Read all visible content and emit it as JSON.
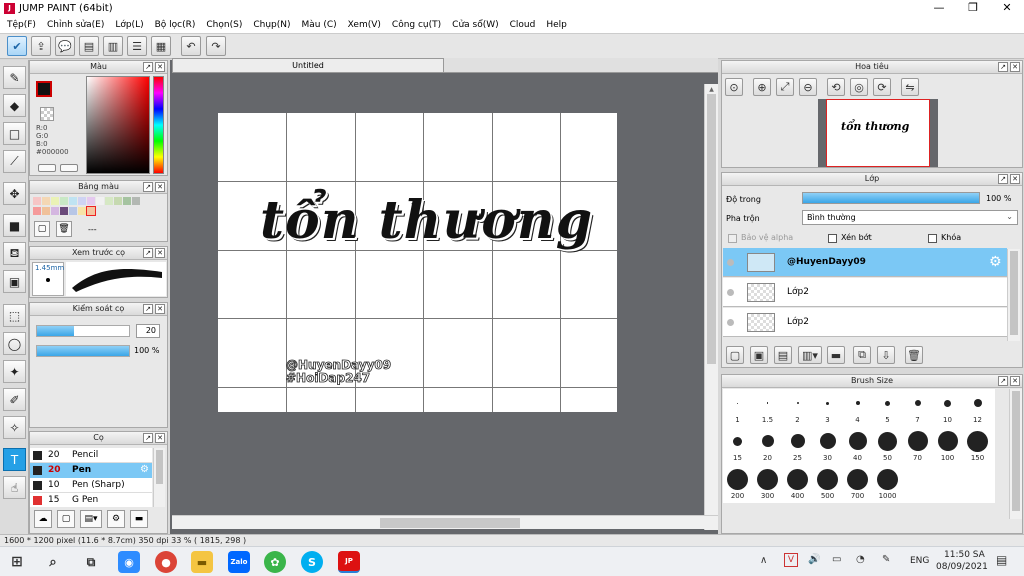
{
  "window": {
    "title": "JUMP PAINT (64bit)",
    "minimize": "—",
    "maximize": "❐",
    "close": "✕"
  },
  "menu": [
    "Tệp(F)",
    "Chỉnh sửa(E)",
    "Lớp(L)",
    "Bộ lọc(R)",
    "Chọn(S)",
    "Chụp(N)",
    "Màu (C)",
    "Xem(V)",
    "Công cụ(T)",
    "Cửa sổ(W)",
    "Cloud",
    "Help"
  ],
  "color_panel": {
    "title": "Màu",
    "r": "R:0",
    "g": "G:0",
    "b": "B:0",
    "hex": "#000000"
  },
  "palette_panel": {
    "title": "Bảng màu",
    "extra": "---"
  },
  "brush_preview_panel": {
    "title": "Xem trước cọ",
    "size": "1.45mm"
  },
  "brush_control_panel": {
    "title": "Kiểm soát cọ",
    "size_value": "20",
    "opacity_value": "100 %",
    "size_level": 0.4,
    "opacity_level": 1.0
  },
  "brush_panel": {
    "title": "Cọ",
    "items": [
      {
        "size": "20",
        "name": "Pencil",
        "color": "#222222"
      },
      {
        "size": "20",
        "name": "Pen",
        "color": "#222222",
        "selected": true
      },
      {
        "size": "10",
        "name": "Pen (Sharp)",
        "color": "#222222"
      },
      {
        "size": "15",
        "name": "G Pen",
        "color": "#e03030"
      }
    ]
  },
  "document": {
    "tab": "Untitled",
    "artwork_title": "tổn thương",
    "signature_line1": "@HuyenDayy09",
    "signature_line2": "#HoiDap247"
  },
  "navigator_panel": {
    "title": "Hoa tiêu",
    "thumb_text": "tổn thương"
  },
  "layer_panel": {
    "title": "Lớp",
    "opacity_label": "Độ trong",
    "opacity_value": "100 %",
    "blend_label": "Pha trộn",
    "blend_value": "Bình thường",
    "protect_alpha": "Bảo vệ alpha",
    "clip": "Xén bớt",
    "lock": "Khóa",
    "layers": [
      {
        "name": "@HuyenDayy09",
        "selected": true
      },
      {
        "name": "Lớp2",
        "selected": false
      },
      {
        "name": "Lớp2",
        "selected": false
      }
    ]
  },
  "brush_size_panel": {
    "title": "Brush Size",
    "sizes": [
      "1",
      "1.5",
      "2",
      "3",
      "4",
      "5",
      "7",
      "10",
      "12",
      "15",
      "20",
      "25",
      "30",
      "40",
      "50",
      "70",
      "100",
      "150",
      "200",
      "300",
      "400",
      "500",
      "700",
      "1000"
    ]
  },
  "status": {
    "text": "1600 * 1200 pixel   (11.6 * 8.7cm)   350 dpi   33 %   ( 1815, 298 )"
  },
  "taskbar": {
    "lang": "ENG",
    "time": "11:50 SA",
    "date": "08/09/2021"
  },
  "colors": {
    "accent": "#25a0e6",
    "selected_row": "#7bc8f5",
    "canvas_bg": "#65676b"
  }
}
